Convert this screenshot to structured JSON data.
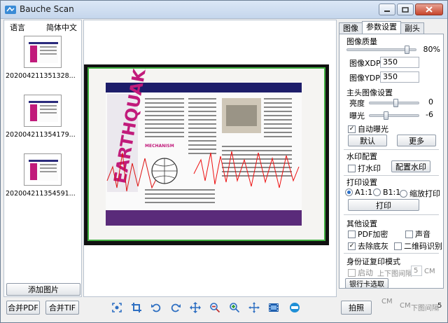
{
  "window": {
    "title": "Bauche Scan"
  },
  "left": {
    "language_label": "语言",
    "language_value": "简体中文",
    "thumbnails": [
      {
        "caption": "202004211351328..."
      },
      {
        "caption": "202004211354179..."
      },
      {
        "caption": "202004211354591..."
      }
    ],
    "add_image_label": "添加图片"
  },
  "tabs": [
    {
      "label": "图像"
    },
    {
      "label": "参数设置"
    },
    {
      "label": "副头"
    }
  ],
  "settings": {
    "image_quality_title": "图像质量",
    "quality_value": "80%",
    "quality_level": 0.8,
    "xdpi_label": "图像XDPI",
    "xdpi_value": "350",
    "ydpi_label": "图像YDPI",
    "ydpi_value": "350",
    "main_image_title": "主头图像设置",
    "brightness_label": "亮度",
    "brightness_value": "0",
    "exposure_label": "曝光",
    "exposure_value": "-6",
    "auto_exposure_label": "自动曝光",
    "auto_exposure_checked": true,
    "default_button": "默认",
    "more_button": "更多",
    "watermark_title": "水印配置",
    "watermark_check_label": "打水印",
    "watermark_config_button": "配置水印",
    "print_title": "打印设置",
    "print_a1_label": "A1:1",
    "print_b1_label": "B1:1",
    "print_scale_label": "缩放打印",
    "print_button": "打印",
    "other_title": "其他设置",
    "pdf_encrypt_label": "PDF加密",
    "sound_label": "声音",
    "remove_bg_label": "去除底灰",
    "qr_label": "二维码识别",
    "remove_bg_checked": true,
    "id_copy_title": "身份证复印模式",
    "enable_label": "启动",
    "gap_label": "上下图间隔",
    "gap_value": "5",
    "gap_unit": "CM",
    "group_read_button": "银行卡选取"
  },
  "bottom": {
    "merge_pdf": "合并PDF",
    "merge_tif": "合并TIF",
    "capture": "拍照",
    "hint_cm": "CM",
    "hint_gap": "下图间隔",
    "hint_gap_value": "5"
  },
  "page_text": {
    "headline": "EARTHQUAKE",
    "subhead": "MECHANISM"
  },
  "colors": {
    "accent_green": "#3fae3f",
    "headline": "#c11b7b"
  }
}
